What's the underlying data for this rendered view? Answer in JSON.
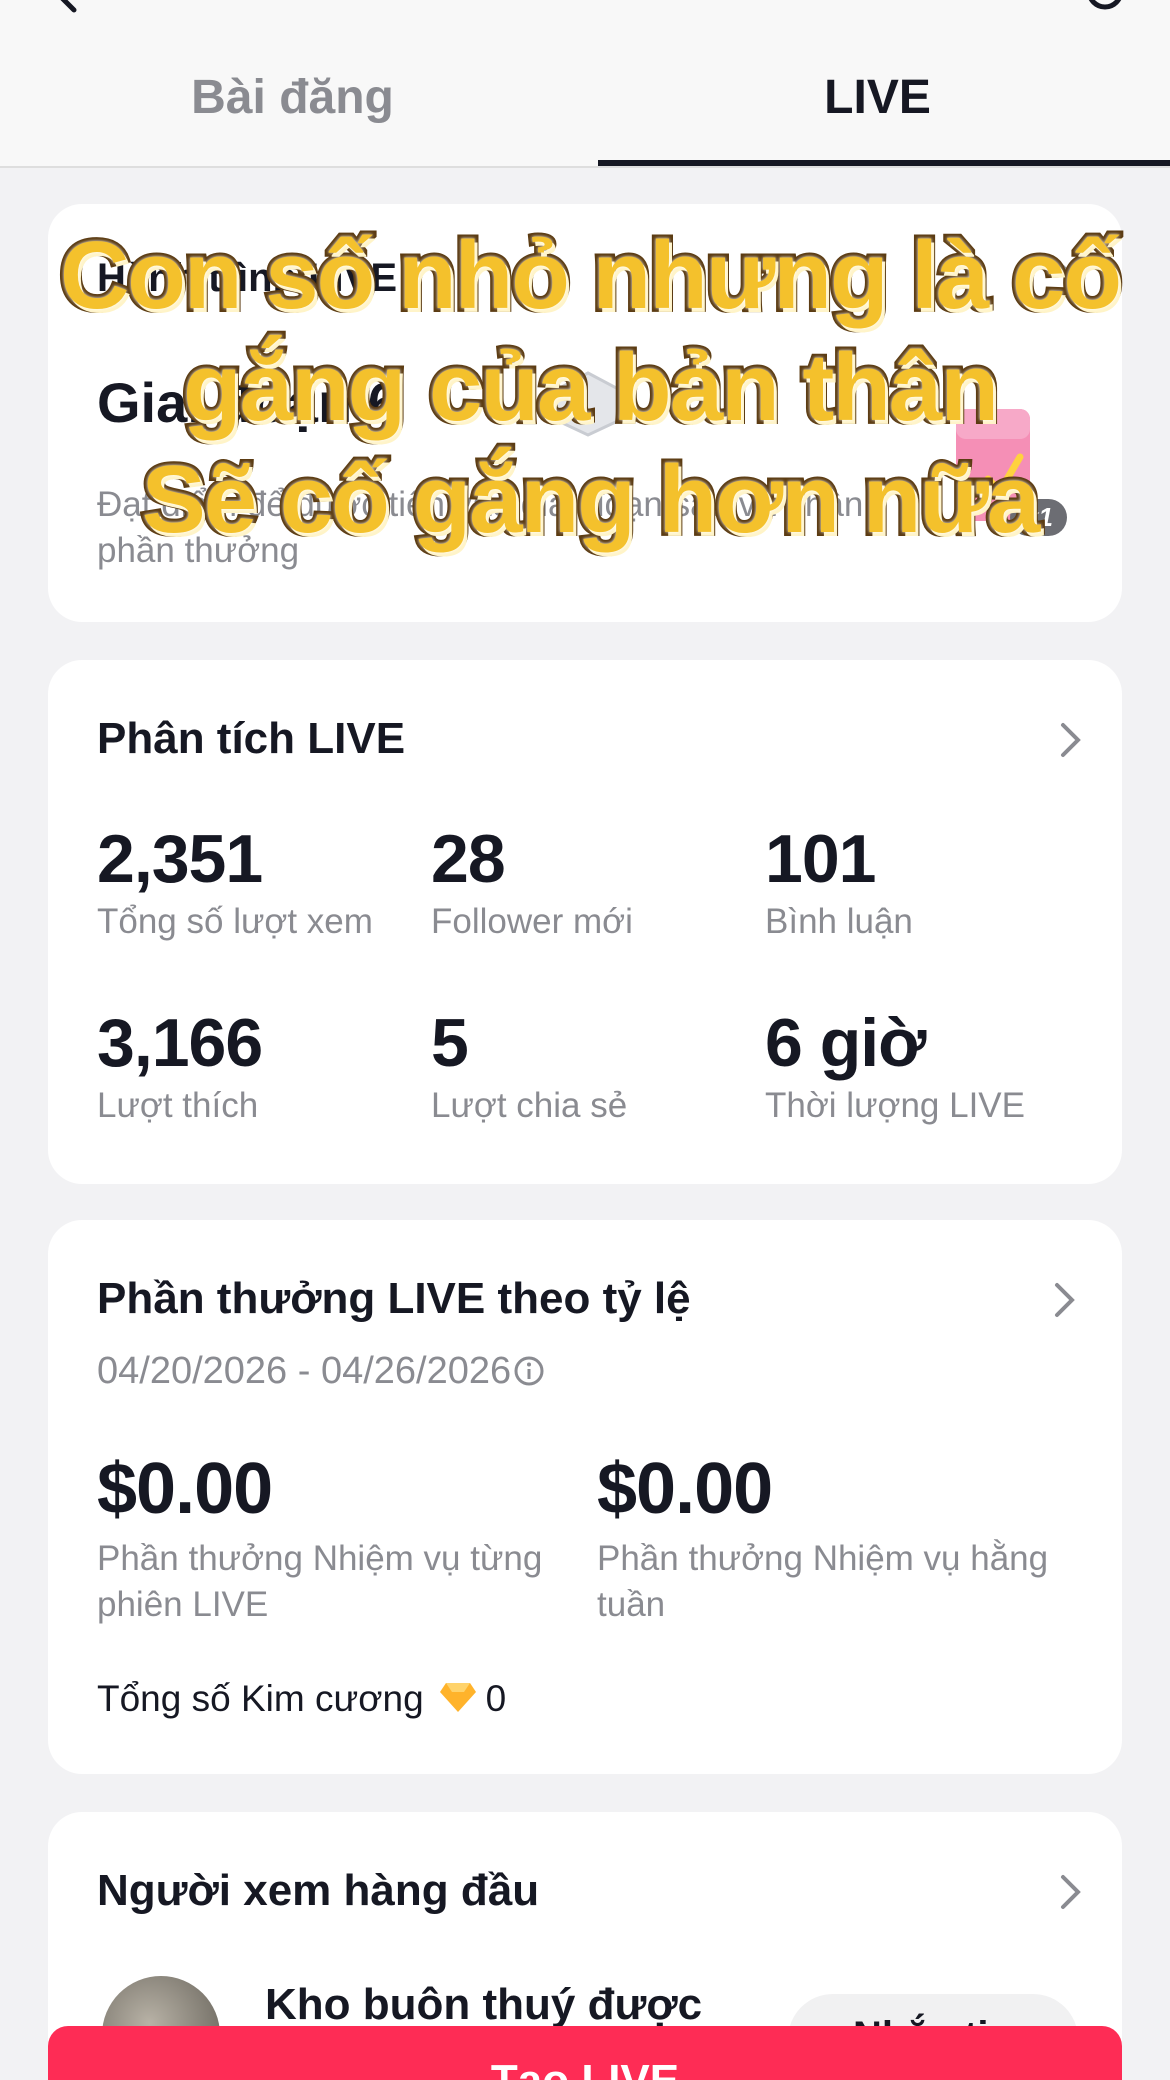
{
  "tabs": [
    {
      "label": "Bài đăng"
    },
    {
      "label": "LIVE"
    }
  ],
  "card_goal": {
    "title": "Hành trình LIVE",
    "level": "Giai đoạn 6",
    "description": "Đạt điểm để được tiến vào giai đoạn sau và nhận phần thưởng",
    "multiplier": "x1"
  },
  "overlay": {
    "line1": "Con số nhỏ nhưng là cố",
    "line2": "gắng của bản thân",
    "line3": "Sẽ cố gắng hơn nữa",
    "color": "#f4c12c"
  },
  "analytics": {
    "title": "Phân tích LIVE",
    "stats": [
      {
        "value": "2,351",
        "label": "Tổng số lượt xem"
      },
      {
        "value": "28",
        "label": "Follower mới"
      },
      {
        "value": "101",
        "label": "Bình luận"
      },
      {
        "value": "3,166",
        "label": "Lượt thích"
      },
      {
        "value": "5",
        "label": "Lượt chia sẻ"
      },
      {
        "value": "6 giờ",
        "label": "Thời lượng LIVE"
      }
    ]
  },
  "rewards": {
    "title": "Phần thưởng LIVE theo tỷ lệ",
    "range": "04/20/2026 - 04/26/2026",
    "items": [
      {
        "value": "$0.00",
        "label": "Phần thưởng Nhiệm vụ từng phiên LIVE"
      },
      {
        "value": "$0.00",
        "label": "Phần thưởng Nhiệm vụ hằng tuần"
      }
    ],
    "diamonds_label": "Tổng số Kim cương",
    "diamonds_value": "0"
  },
  "top_viewers": {
    "title": "Người xem hàng đầu",
    "first_viewer": "Kho buôn thuý được",
    "message_label": "Nhắn tin"
  },
  "cta": {
    "label": "Tạo LIVE"
  },
  "colors": {
    "accent": "#fe2c55",
    "text": "#161823",
    "muted": "#8a8b91"
  }
}
